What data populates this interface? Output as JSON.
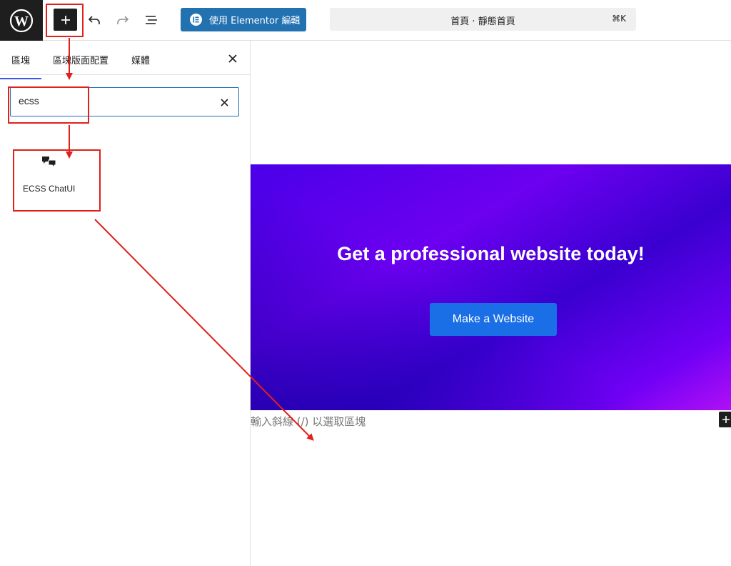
{
  "topbar": {
    "elementor_label": "使用 Elementor 編輯",
    "document_title": "首頁 · 靜態首頁",
    "shortcut": "⌘K",
    "icons": [
      "wordpress-logo-icon",
      "plus-icon",
      "undo-icon",
      "redo-icon",
      "document-overview-icon",
      "elementor-logo-icon"
    ]
  },
  "sidebar": {
    "tabs": [
      "區塊",
      "區塊版面配置",
      "媒體"
    ],
    "search": {
      "value": "ecss"
    },
    "results": [
      {
        "label": "ECSS ChatUI",
        "icon": "chat-bubbles-icon"
      }
    ]
  },
  "canvas": {
    "hero_title": "Get a professional website today!",
    "hero_button": "Make a Website",
    "placeholder": "輸入斜線 (/) 以選取區塊",
    "hero_colors": [
      "#4a00e8",
      "#7000f5",
      "#b010f5"
    ],
    "button_color": "#1a6fe6"
  },
  "annotations": {
    "color": "#e0201b"
  }
}
